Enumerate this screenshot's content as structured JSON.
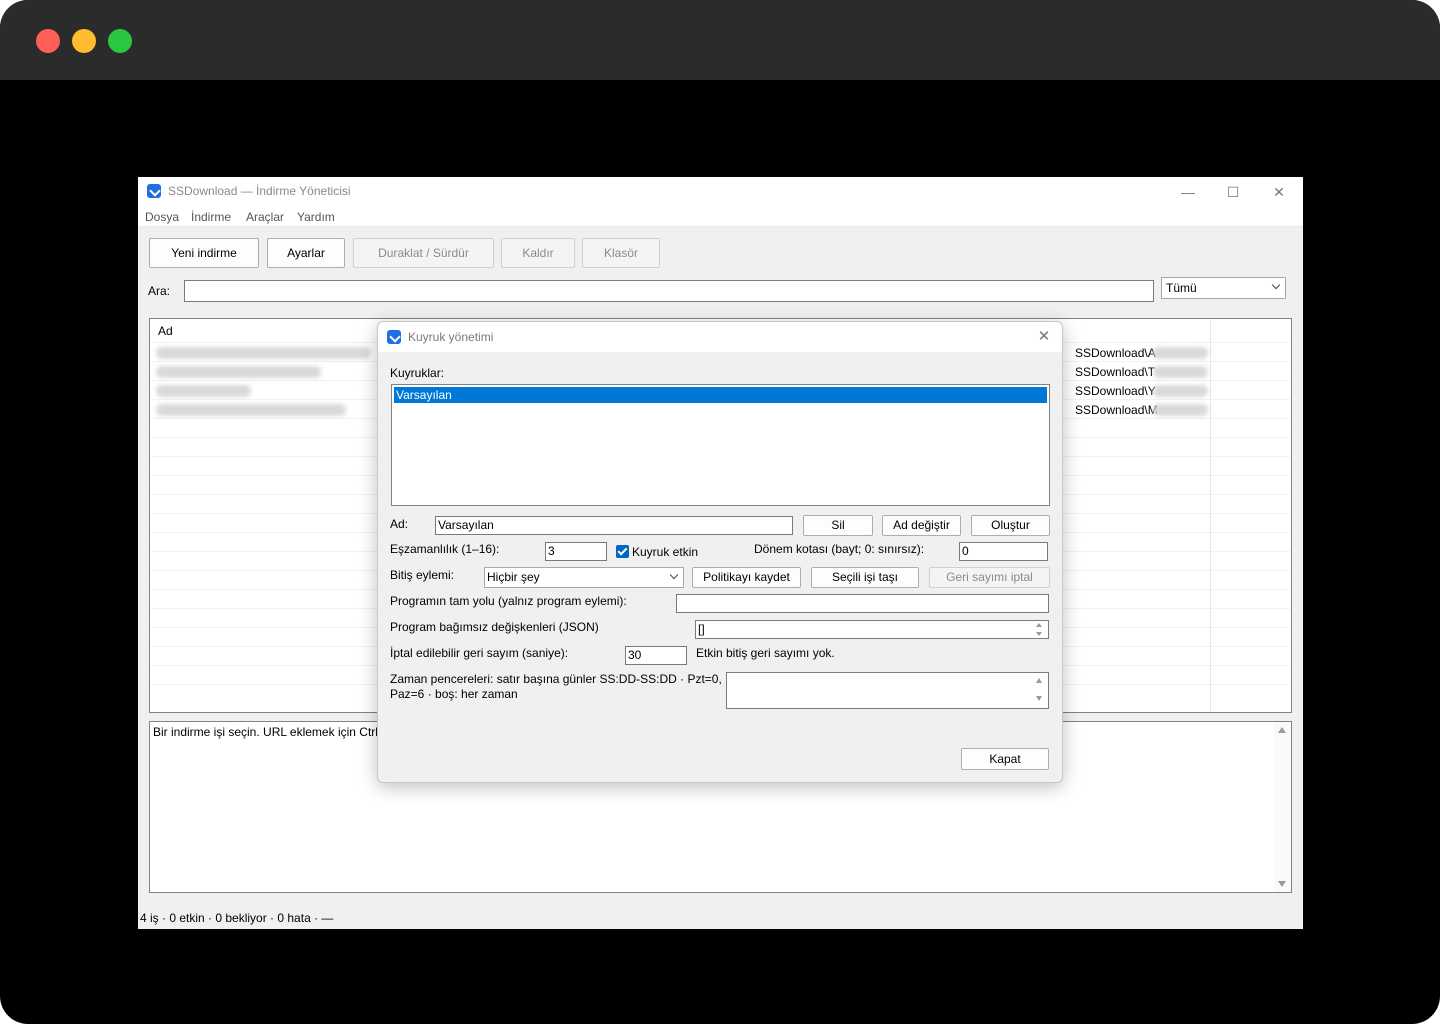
{
  "window": {
    "title": "SSDownload — İndirme Yöneticisi",
    "controls": {
      "minimize": "—",
      "maximize": "☐",
      "close": "✕"
    }
  },
  "menu": [
    "Dosya",
    "İndirme",
    "Araçlar",
    "Yardım"
  ],
  "toolbar": {
    "new_download": "Yeni indirme",
    "settings": "Ayarlar",
    "pause_resume": "Duraklat / Sürdür",
    "remove": "Kaldır",
    "folder": "Klasör"
  },
  "search": {
    "label": "Ara:",
    "value": "",
    "filter_selected": "Tümü"
  },
  "downloads": {
    "column_name": "Ad",
    "rows": [
      {
        "path": "SSDownload\\A"
      },
      {
        "path": "SSDownload\\T"
      },
      {
        "path": "SSDownload\\Y"
      },
      {
        "path": "SSDownload\\M"
      }
    ]
  },
  "log": {
    "text": "Bir indirme işi seçin. URL eklemek için Ctrl+"
  },
  "status": {
    "text": "4 iş · 0 etkin · 0 bekliyor · 0 hata · —"
  },
  "dialog": {
    "title": "Kuyruk yönetimi",
    "close": "✕",
    "queues_label": "Kuyruklar:",
    "queues": [
      "Varsayılan"
    ],
    "name_label": "Ad:",
    "name_value": "Varsayılan",
    "delete_btn": "Sil",
    "rename_btn": "Ad değiştir",
    "create_btn": "Oluştur",
    "concurrency_label": "Eşzamanlılık (1–16):",
    "concurrency_value": "3",
    "queue_enabled_label": "Kuyruk etkin",
    "quota_label": "Dönem kotası (bayt; 0: sınırsız):",
    "quota_value": "0",
    "finish_action_label": "Bitiş eylemi:",
    "finish_action_value": "Hiçbir şey",
    "save_policy_btn": "Politikayı kaydet",
    "move_job_btn": "Seçili işi taşı",
    "cancel_countdown_btn": "Geri sayımı iptal",
    "program_path_label": "Programın tam yolu (yalnız program eylemi):",
    "program_path_value": "",
    "program_args_label": "Program bağımsız değişkenleri (JSON)",
    "program_args_value": "[]",
    "countdown_label": "İptal edilebilir geri sayım (saniye):",
    "countdown_value": "30",
    "countdown_status": "Etkin bitiş geri sayımı yok.",
    "windows_label_line1": "Zaman pencereleri: satır başına günler SS:DD-SS:DD · Pzt=0,",
    "windows_label_line2": "Paz=6 · boş: her zaman",
    "windows_value": "",
    "close_btn": "Kapat"
  }
}
